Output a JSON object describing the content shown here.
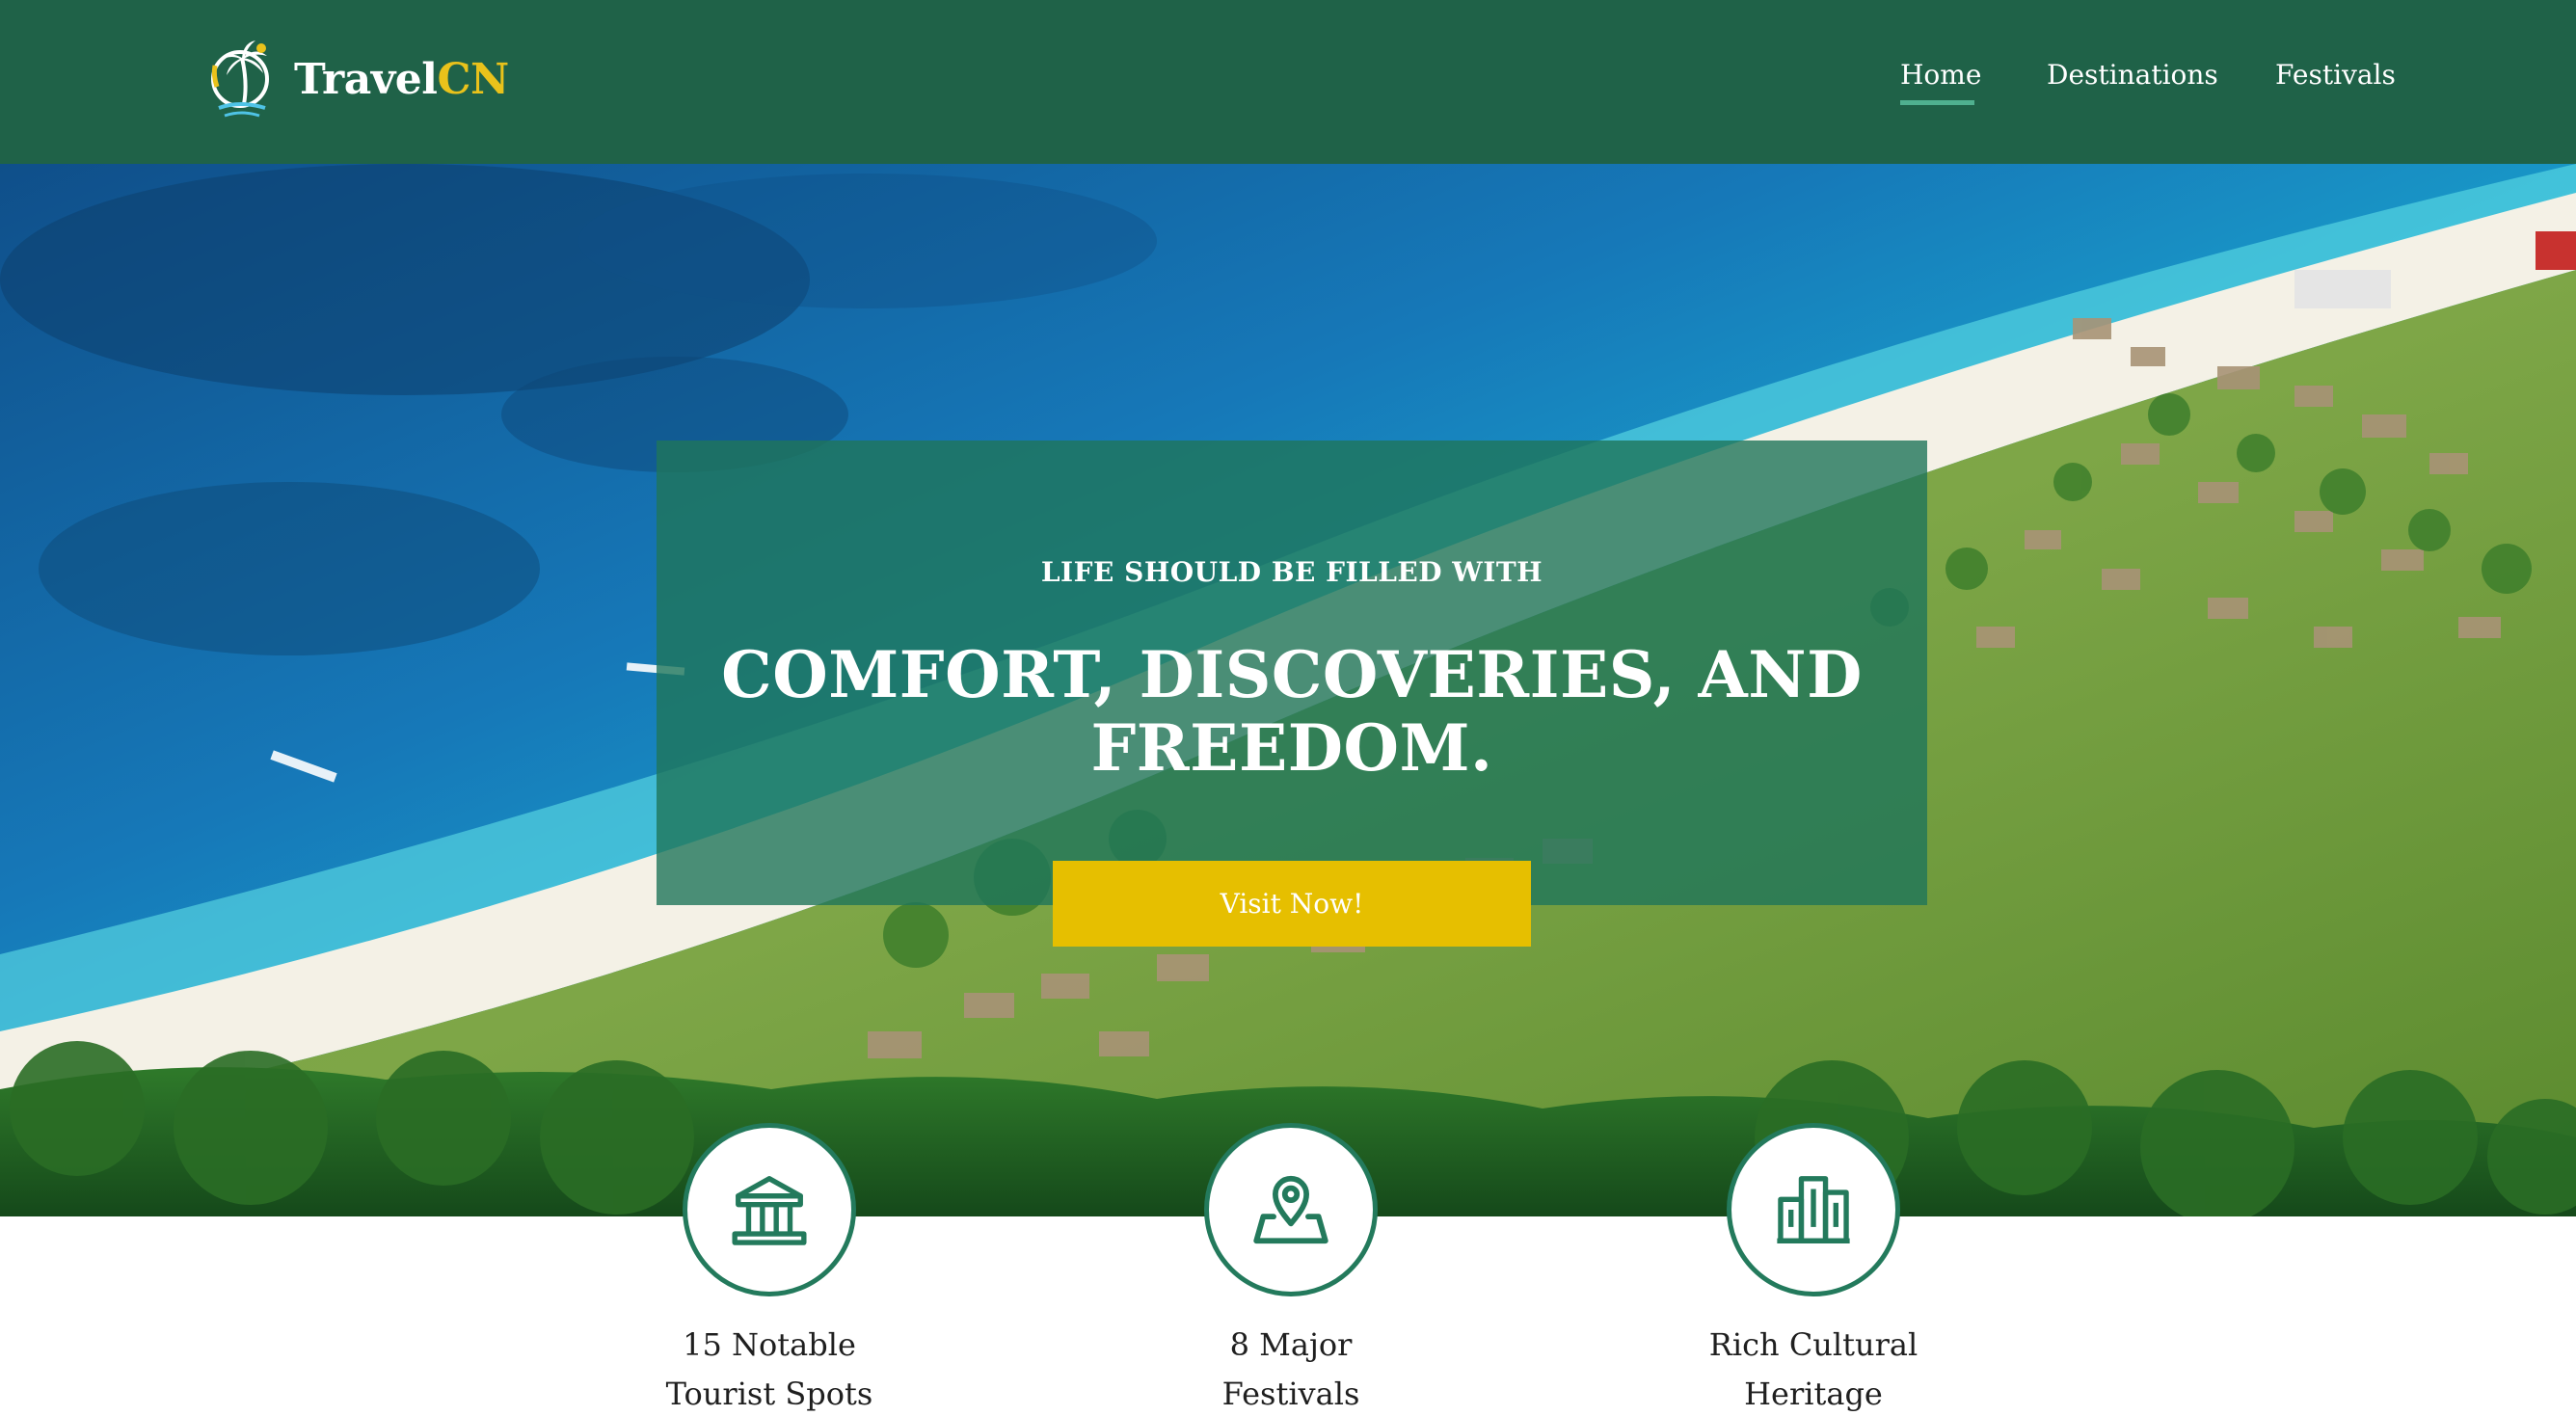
{
  "brand": {
    "name_part1": "Travel",
    "name_part2": "CN",
    "accent": "#e9c21b",
    "header_bg": "#1f6248"
  },
  "nav": {
    "items": [
      {
        "label": "Home",
        "active": true
      },
      {
        "label": "Destinations",
        "active": false
      },
      {
        "label": "Festivals",
        "active": false
      }
    ]
  },
  "hero": {
    "subtitle": "LIFE SHOULD BE FILLED WITH",
    "title_line1": "COMFORT, DISCOVERIES, AND",
    "title_line2": "FREEDOM.",
    "cta_label": "Visit Now!",
    "cta_color": "#e6bf00"
  },
  "features": [
    {
      "icon": "landmark-icon",
      "line1": "15 Notable",
      "line2": "Tourist Spots"
    },
    {
      "icon": "map-pin-icon",
      "line1": "8 Major",
      "line2": "Festivals"
    },
    {
      "icon": "buildings-icon",
      "line1": "Rich Cultural",
      "line2": "Heritage"
    }
  ]
}
